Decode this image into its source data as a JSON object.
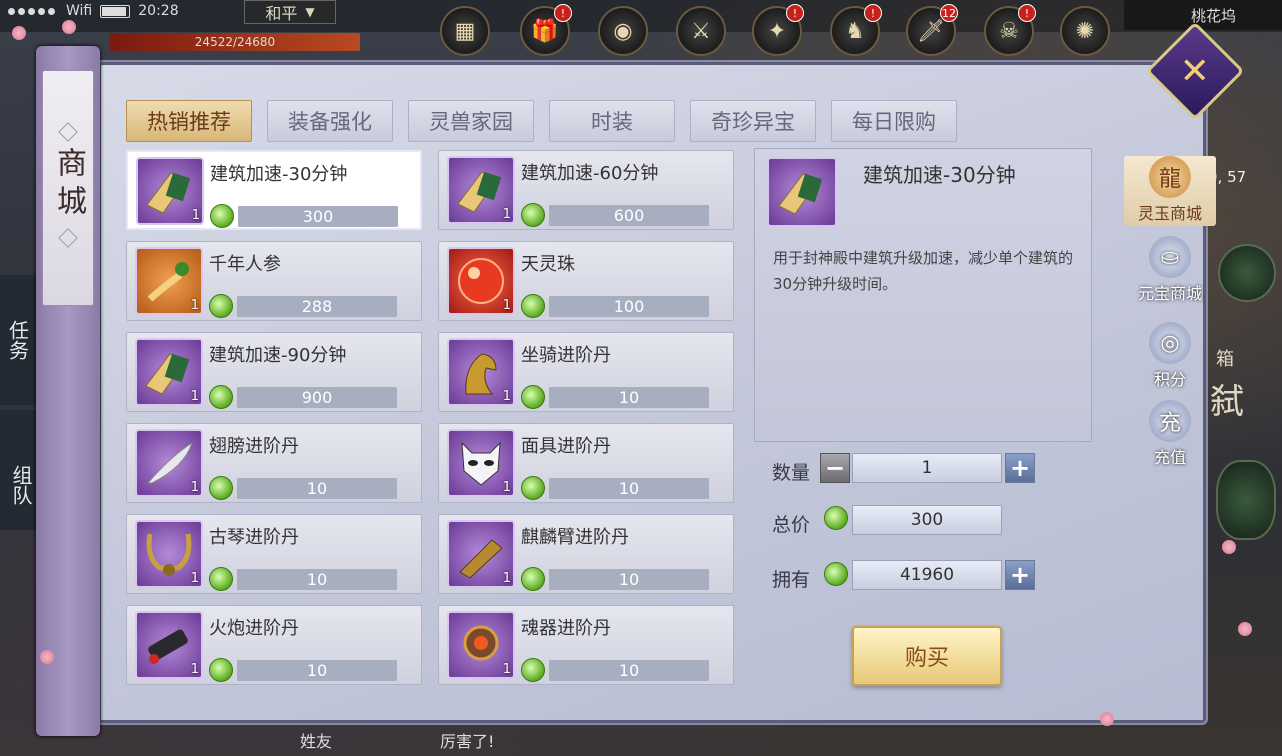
{
  "status_bar": {
    "wifi": "Wifi",
    "time": "20:28",
    "mode": "和平"
  },
  "hp": {
    "text": "24522/24680"
  },
  "top_badges": [
    "!",
    "!",
    "!",
    "12",
    "!"
  ],
  "location": "桃花坞",
  "coords": "9, 57",
  "side_left": {
    "task": "任务",
    "team": "组队"
  },
  "bottom_chat": {
    "left": "姓友",
    "right": "厉害了!"
  },
  "right_glyphs": {
    "box": "箱",
    "char": "弑"
  },
  "shop": {
    "title": "商城",
    "tabs": [
      {
        "label": "热销推荐",
        "active": true
      },
      {
        "label": "装备强化",
        "active": false
      },
      {
        "label": "灵兽家园",
        "active": false
      },
      {
        "label": "时装",
        "active": false
      },
      {
        "label": "奇珍异宝",
        "active": false
      },
      {
        "label": "每日限购",
        "active": false
      }
    ],
    "items": [
      {
        "name": "建筑加速-30分钟",
        "price": "300",
        "qty": "1",
        "icon": "scroll-icon",
        "bg": "purple"
      },
      {
        "name": "建筑加速-60分钟",
        "price": "600",
        "qty": "1",
        "icon": "scroll-icon",
        "bg": "purple"
      },
      {
        "name": "千年人参",
        "price": "288",
        "qty": "1",
        "icon": "ginseng-icon",
        "bg": "orange"
      },
      {
        "name": "天灵珠",
        "price": "100",
        "qty": "1",
        "icon": "orb-icon",
        "bg": "red"
      },
      {
        "name": "建筑加速-90分钟",
        "price": "900",
        "qty": "1",
        "icon": "scroll-icon",
        "bg": "purple"
      },
      {
        "name": "坐骑进阶丹",
        "price": "10",
        "qty": "1",
        "icon": "horse-icon",
        "bg": "purple"
      },
      {
        "name": "翅膀进阶丹",
        "price": "10",
        "qty": "1",
        "icon": "feather-icon",
        "bg": "purple"
      },
      {
        "name": "面具进阶丹",
        "price": "10",
        "qty": "1",
        "icon": "mask-icon",
        "bg": "purple"
      },
      {
        "name": "古琴进阶丹",
        "price": "10",
        "qty": "1",
        "icon": "lyre-icon",
        "bg": "purple"
      },
      {
        "name": "麒麟臂进阶丹",
        "price": "10",
        "qty": "1",
        "icon": "gauntlet-icon",
        "bg": "purple"
      },
      {
        "name": "火炮进阶丹",
        "price": "10",
        "qty": "1",
        "icon": "cannon-icon",
        "bg": "purple"
      },
      {
        "name": "魂器进阶丹",
        "price": "10",
        "qty": "1",
        "icon": "amulet-icon",
        "bg": "purple"
      }
    ],
    "detail": {
      "name": "建筑加速-30分钟",
      "description": "用于封神殿中建筑升级加速，减少单个建筑的30分钟升级时间。"
    },
    "purchase": {
      "qty_label": "数量",
      "qty_value": "1",
      "total_label": "总价",
      "total_value": "300",
      "own_label": "拥有",
      "own_value": "41960",
      "buy_label": "购买",
      "minus": "−",
      "plus": "+"
    },
    "nav": [
      {
        "label": "灵玉商城",
        "active": true,
        "icon": "dragon-icon"
      },
      {
        "label": "元宝商城",
        "active": false,
        "icon": "ingot-icon"
      },
      {
        "label": "积分",
        "active": false,
        "icon": "bag-icon"
      },
      {
        "label": "充值",
        "active": false,
        "icon": "charge-icon"
      }
    ],
    "nav_glyphs": [
      "龍",
      "⛀",
      "◎",
      "充"
    ],
    "close_glyph": "✕"
  },
  "colors": {
    "tab_active": "#d8b678",
    "price_box": "#a6aec0",
    "coin": "#5aaa20",
    "panel": "#c4c8da"
  }
}
